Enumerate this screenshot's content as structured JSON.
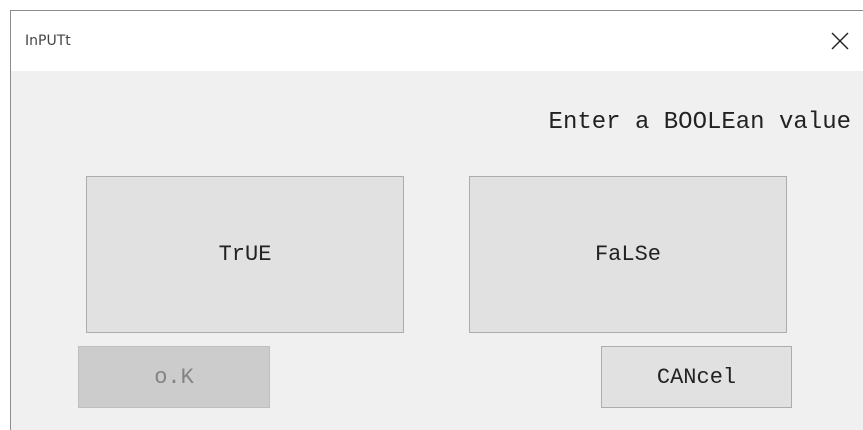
{
  "window": {
    "title": "InPUTt",
    "close_icon": "close-icon"
  },
  "dialog": {
    "prompt": "Enter a BOOLEan value",
    "true_label": "TrUE",
    "false_label": "FaLSe",
    "ok_label": "o.K",
    "ok_enabled": false,
    "cancel_label": "CANcel"
  },
  "colors": {
    "dialog_background": "#f0f0f0",
    "titlebar_background": "#ffffff",
    "button_background": "#e1e1e1",
    "button_border": "#adadad",
    "disabled_button_background": "#cccccc",
    "disabled_text": "#838383"
  }
}
